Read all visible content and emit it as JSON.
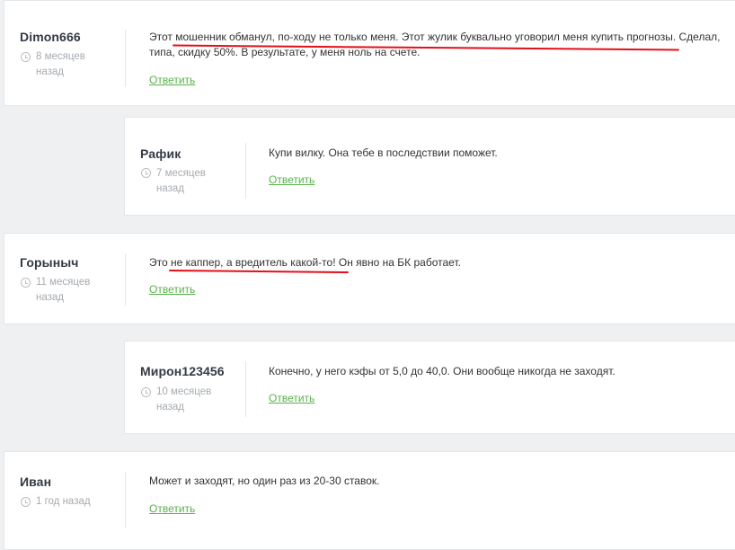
{
  "reply_label": "Ответить",
  "comments": [
    {
      "author": "Dimon666",
      "time_line1": "8 месяцев",
      "time_line2": "назад",
      "text_line1": "Этот мошенник обманул, по-ходу не только меня. Этот жулик буквально уговорил меня купить прогнозы. Сделал,",
      "text_line2": "типа, скидку 50%. В результате, у меня ноль на счете."
    },
    {
      "author": "Рафик",
      "time_line1": "7 месяцев",
      "time_line2": "назад",
      "text_line1": "Купи вилку. Она тебе в последствии поможет."
    },
    {
      "author": "Горыныч",
      "time_line1": "11 месяцев",
      "time_line2": "назад",
      "text_line1": "Это не каппер, а вредитель какой-то! Он явно на БК работает."
    },
    {
      "author": "Мирон123456",
      "time_line1": "10 месяцев",
      "time_line2": "назад",
      "text_line1": "Конечно, у него кэфы от 5,0 до 40,0. Они вообще никогда не заходят."
    },
    {
      "author": "Иван",
      "time_line1": "1 год назад",
      "text_line1": "Может и заходят, но один раз из 20-30 ставок."
    }
  ],
  "colors": {
    "background": "#eef0f1",
    "card": "#ffffff",
    "reply_link": "#58b04b",
    "highlight_underline": "#e2101a"
  }
}
